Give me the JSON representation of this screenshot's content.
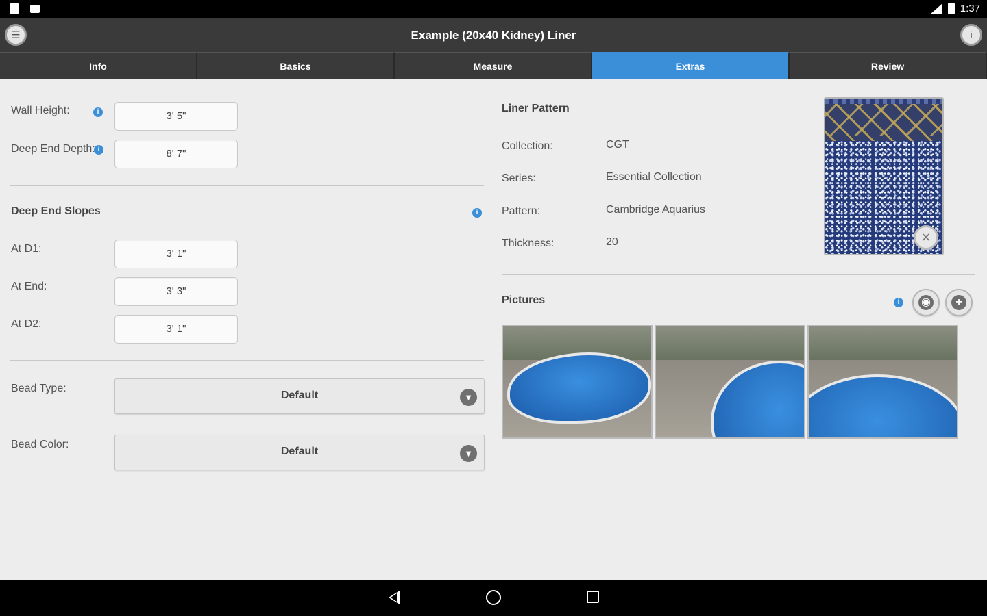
{
  "status_bar": {
    "time": "1:37"
  },
  "header": {
    "title": "Example (20x40 Kidney) Liner",
    "left_icon": "menu-icon",
    "right_icon": "info-circle-icon"
  },
  "tabs": [
    {
      "label": "Info",
      "active": false
    },
    {
      "label": "Basics",
      "active": false
    },
    {
      "label": "Measure",
      "active": false
    },
    {
      "label": "Extras",
      "active": true
    },
    {
      "label": "Review",
      "active": false
    }
  ],
  "accent_color": "#3a8fd8",
  "depth": {
    "wall_height_label": "Wall Height:",
    "wall_height_value": "3' 5\"",
    "deep_end_label": "Deep End Depth:",
    "deep_end_value": "8' 7\""
  },
  "slopes": {
    "title": "Deep End Slopes",
    "d1_label": "At D1:",
    "d1_value": "3' 1\"",
    "end_label": "At End:",
    "end_value": "3' 3\"",
    "d2_label": "At D2:",
    "d2_value": "3' 1\""
  },
  "bead": {
    "type_label": "Bead Type:",
    "type_value": "Default",
    "color_label": "Bead Color:",
    "color_value": "Default"
  },
  "liner_pattern": {
    "title": "Liner Pattern",
    "collection_label": "Collection:",
    "collection_value": "CGT",
    "series_label": "Series:",
    "series_value": "Essential Collection",
    "pattern_label": "Pattern:",
    "pattern_value": "Cambridge Aquarius",
    "thickness_label": "Thickness:",
    "thickness_value": "20"
  },
  "pictures": {
    "title": "Pictures",
    "count": 3
  }
}
